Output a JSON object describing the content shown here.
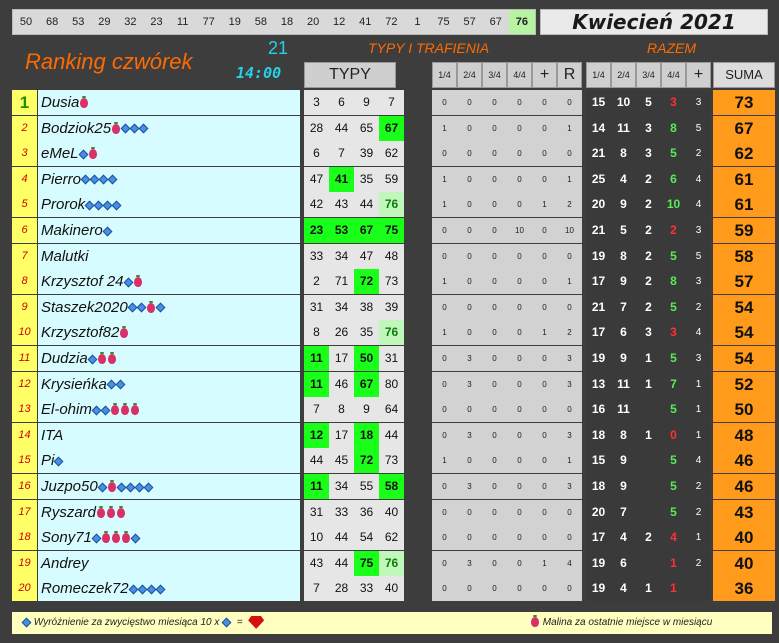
{
  "top_numbers": [
    "50",
    "68",
    "53",
    "29",
    "32",
    "23",
    "11",
    "77",
    "19",
    "58",
    "18",
    "20",
    "12",
    "41",
    "72",
    "1",
    "75",
    "57",
    "67",
    "76"
  ],
  "highlight_number": "76",
  "month": "Kwiecień 2021",
  "title": "Ranking czwórek",
  "round": "21",
  "time": "14:00",
  "typy_trafienia": "TYPY I TRAFIENIA",
  "razem": "RAZEM",
  "headers": {
    "typy": "TYPY",
    "s1": "1/4",
    "s2": "2/4",
    "s3": "3/4",
    "s4": "4/4",
    "plus": "+",
    "r": "R",
    "z1": "1/4",
    "z2": "2/4",
    "z3": "3/4",
    "z4": "4/4",
    "zplus": "+",
    "suma": "SUMA"
  },
  "colors": {
    "title": "#ff6a00",
    "round": "#26d0e8",
    "rank_bg": "#ffff66",
    "name_bg": "#d6fcff",
    "hit": "#19ff19",
    "sum_bg": "#ff9a1a"
  },
  "rows": [
    {
      "rank": "1",
      "name": "Dusia",
      "icons": [
        "berry"
      ],
      "typy": [
        "3",
        "6",
        "9",
        "7"
      ],
      "hits": [],
      "late": [],
      "scores": [
        "0",
        "0",
        "0",
        "0",
        "0",
        "0"
      ],
      "razem": [
        "15",
        "10",
        "5",
        "3"
      ],
      "zplus": "3",
      "suma": "73"
    },
    {
      "rank": "2",
      "name": "Bodziok25",
      "icons": [
        "berry",
        "gem",
        "gem",
        "gem"
      ],
      "typy": [
        "28",
        "44",
        "65",
        "67"
      ],
      "hits": [
        3
      ],
      "late": [],
      "scores": [
        "1",
        "0",
        "0",
        "0",
        "0",
        "1"
      ],
      "razem": [
        "14",
        "11",
        "3",
        "8"
      ],
      "zplus": "5",
      "suma": "67"
    },
    {
      "rank": "3",
      "name": "eMeL",
      "icons": [
        "gem",
        "berry"
      ],
      "typy": [
        "6",
        "7",
        "39",
        "62"
      ],
      "hits": [],
      "late": [],
      "scores": [
        "0",
        "0",
        "0",
        "0",
        "0",
        "0"
      ],
      "razem": [
        "21",
        "8",
        "3",
        "5"
      ],
      "zplus": "2",
      "suma": "62"
    },
    {
      "rank": "4",
      "name": "Pierro",
      "icons": [
        "gem",
        "gem",
        "gem",
        "gem"
      ],
      "typy": [
        "47",
        "41",
        "35",
        "59"
      ],
      "hits": [
        1
      ],
      "late": [],
      "scores": [
        "1",
        "0",
        "0",
        "0",
        "0",
        "1"
      ],
      "razem": [
        "25",
        "4",
        "2",
        "6"
      ],
      "zplus": "4",
      "suma": "61"
    },
    {
      "rank": "5",
      "name": "Prorok",
      "icons": [
        "gem",
        "gem",
        "gem",
        "gem"
      ],
      "typy": [
        "42",
        "43",
        "44",
        "76"
      ],
      "hits": [],
      "late": [
        3
      ],
      "scores": [
        "1",
        "0",
        "0",
        "0",
        "1",
        "2"
      ],
      "razem": [
        "20",
        "9",
        "2",
        "10"
      ],
      "zplus": "4",
      "suma": "61"
    },
    {
      "rank": "6",
      "name": "Makinero",
      "icons": [
        "gem"
      ],
      "typy": [
        "23",
        "53",
        "67",
        "75"
      ],
      "hits": [
        0,
        1,
        2,
        3
      ],
      "late": [],
      "scores": [
        "0",
        "0",
        "0",
        "10",
        "0",
        "10"
      ],
      "razem": [
        "21",
        "5",
        "2",
        "2"
      ],
      "zplus": "3",
      "suma": "59"
    },
    {
      "rank": "7",
      "name": "Malutki",
      "icons": [],
      "typy": [
        "33",
        "34",
        "47",
        "48"
      ],
      "hits": [],
      "late": [],
      "scores": [
        "0",
        "0",
        "0",
        "0",
        "0",
        "0"
      ],
      "razem": [
        "19",
        "8",
        "2",
        "5"
      ],
      "zplus": "5",
      "suma": "58"
    },
    {
      "rank": "8",
      "name": "Krzysztof 24",
      "icons": [
        "gem",
        "berry"
      ],
      "typy": [
        "2",
        "71",
        "72",
        "73"
      ],
      "hits": [
        2
      ],
      "late": [],
      "scores": [
        "1",
        "0",
        "0",
        "0",
        "0",
        "1"
      ],
      "razem": [
        "17",
        "9",
        "2",
        "8"
      ],
      "zplus": "3",
      "suma": "57"
    },
    {
      "rank": "9",
      "name": "Staszek2020",
      "icons": [
        "gem",
        "gem",
        "berry",
        "gem"
      ],
      "typy": [
        "31",
        "34",
        "38",
        "39"
      ],
      "hits": [],
      "late": [],
      "scores": [
        "0",
        "0",
        "0",
        "0",
        "0",
        "0"
      ],
      "razem": [
        "21",
        "7",
        "2",
        "5"
      ],
      "zplus": "2",
      "suma": "54"
    },
    {
      "rank": "10",
      "name": "Krzysztof82",
      "icons": [
        "berry"
      ],
      "typy": [
        "8",
        "26",
        "35",
        "76"
      ],
      "hits": [],
      "late": [
        3
      ],
      "scores": [
        "1",
        "0",
        "0",
        "0",
        "1",
        "2"
      ],
      "razem": [
        "17",
        "6",
        "3",
        "3"
      ],
      "zplus": "4",
      "suma": "54"
    },
    {
      "rank": "11",
      "name": "Dudzia",
      "icons": [
        "gem",
        "berry",
        "berry"
      ],
      "typy": [
        "11",
        "17",
        "50",
        "31"
      ],
      "hits": [
        0,
        2
      ],
      "late": [],
      "scores": [
        "0",
        "3",
        "0",
        "0",
        "0",
        "3"
      ],
      "razem": [
        "19",
        "9",
        "1",
        "5"
      ],
      "zplus": "3",
      "suma": "54"
    },
    {
      "rank": "12",
      "name": "Krysieńka",
      "icons": [
        "gem",
        "gem"
      ],
      "typy": [
        "11",
        "46",
        "67",
        "80"
      ],
      "hits": [
        0,
        2
      ],
      "late": [],
      "scores": [
        "0",
        "3",
        "0",
        "0",
        "0",
        "3"
      ],
      "razem": [
        "13",
        "11",
        "1",
        "7"
      ],
      "zplus": "1",
      "suma": "52"
    },
    {
      "rank": "13",
      "name": "El-ohim",
      "icons": [
        "gem",
        "gem",
        "berry",
        "berry",
        "berry"
      ],
      "typy": [
        "7",
        "8",
        "9",
        "64"
      ],
      "hits": [],
      "late": [],
      "scores": [
        "0",
        "0",
        "0",
        "0",
        "0",
        "0"
      ],
      "razem": [
        "16",
        "11",
        "",
        "5"
      ],
      "zplus": "1",
      "suma": "50"
    },
    {
      "rank": "14",
      "name": "ITA",
      "icons": [],
      "typy": [
        "12",
        "17",
        "18",
        "44"
      ],
      "hits": [
        0,
        2
      ],
      "late": [],
      "scores": [
        "0",
        "3",
        "0",
        "0",
        "0",
        "3"
      ],
      "razem": [
        "18",
        "8",
        "1",
        "0"
      ],
      "zplus": "1",
      "suma": "48"
    },
    {
      "rank": "15",
      "name": "Pi",
      "icons": [
        "gem"
      ],
      "typy": [
        "44",
        "45",
        "72",
        "73"
      ],
      "hits": [
        2
      ],
      "late": [],
      "scores": [
        "1",
        "0",
        "0",
        "0",
        "0",
        "1"
      ],
      "razem": [
        "15",
        "9",
        "",
        "5"
      ],
      "zplus": "4",
      "suma": "46"
    },
    {
      "rank": "16",
      "name": "Juzpo50",
      "icons": [
        "gem",
        "berry",
        "gem",
        "gem",
        "gem",
        "gem"
      ],
      "typy": [
        "11",
        "34",
        "55",
        "58"
      ],
      "hits": [
        0,
        3
      ],
      "late": [],
      "scores": [
        "0",
        "3",
        "0",
        "0",
        "0",
        "3"
      ],
      "razem": [
        "18",
        "9",
        "",
        "5"
      ],
      "zplus": "2",
      "suma": "46"
    },
    {
      "rank": "17",
      "name": "Ryszard",
      "icons": [
        "berry",
        "berry",
        "berry"
      ],
      "typy": [
        "31",
        "33",
        "36",
        "40"
      ],
      "hits": [],
      "late": [],
      "scores": [
        "0",
        "0",
        "0",
        "0",
        "0",
        "0"
      ],
      "razem": [
        "20",
        "7",
        "",
        "5"
      ],
      "zplus": "2",
      "suma": "43"
    },
    {
      "rank": "18",
      "name": "Sony71",
      "icons": [
        "gem",
        "berry",
        "berry",
        "berry",
        "gem"
      ],
      "typy": [
        "10",
        "44",
        "54",
        "62"
      ],
      "hits": [],
      "late": [],
      "scores": [
        "0",
        "0",
        "0",
        "0",
        "0",
        "0"
      ],
      "razem": [
        "17",
        "4",
        "2",
        "4"
      ],
      "zplus": "1",
      "suma": "40"
    },
    {
      "rank": "19",
      "name": "Andrey",
      "icons": [],
      "typy": [
        "43",
        "44",
        "75",
        "76"
      ],
      "hits": [
        2
      ],
      "late": [
        3
      ],
      "scores": [
        "0",
        "3",
        "0",
        "0",
        "1",
        "4"
      ],
      "razem": [
        "19",
        "6",
        "",
        "1"
      ],
      "zplus": "2",
      "suma": "40"
    },
    {
      "rank": "20",
      "name": "Romeczek72",
      "icons": [
        "gem",
        "gem",
        "gem",
        "gem"
      ],
      "typy": [
        "7",
        "28",
        "33",
        "40"
      ],
      "hits": [],
      "late": [],
      "scores": [
        "0",
        "0",
        "0",
        "0",
        "0",
        "0"
      ],
      "razem": [
        "19",
        "4",
        "1",
        "1"
      ],
      "zplus": "",
      "suma": "36"
    }
  ],
  "footer": {
    "left": "Wyróżnienie za zwycięstwo miesiąca  10 x",
    "eq": "=",
    "right": "Malina za ostatnie miejsce w miesiącu"
  }
}
